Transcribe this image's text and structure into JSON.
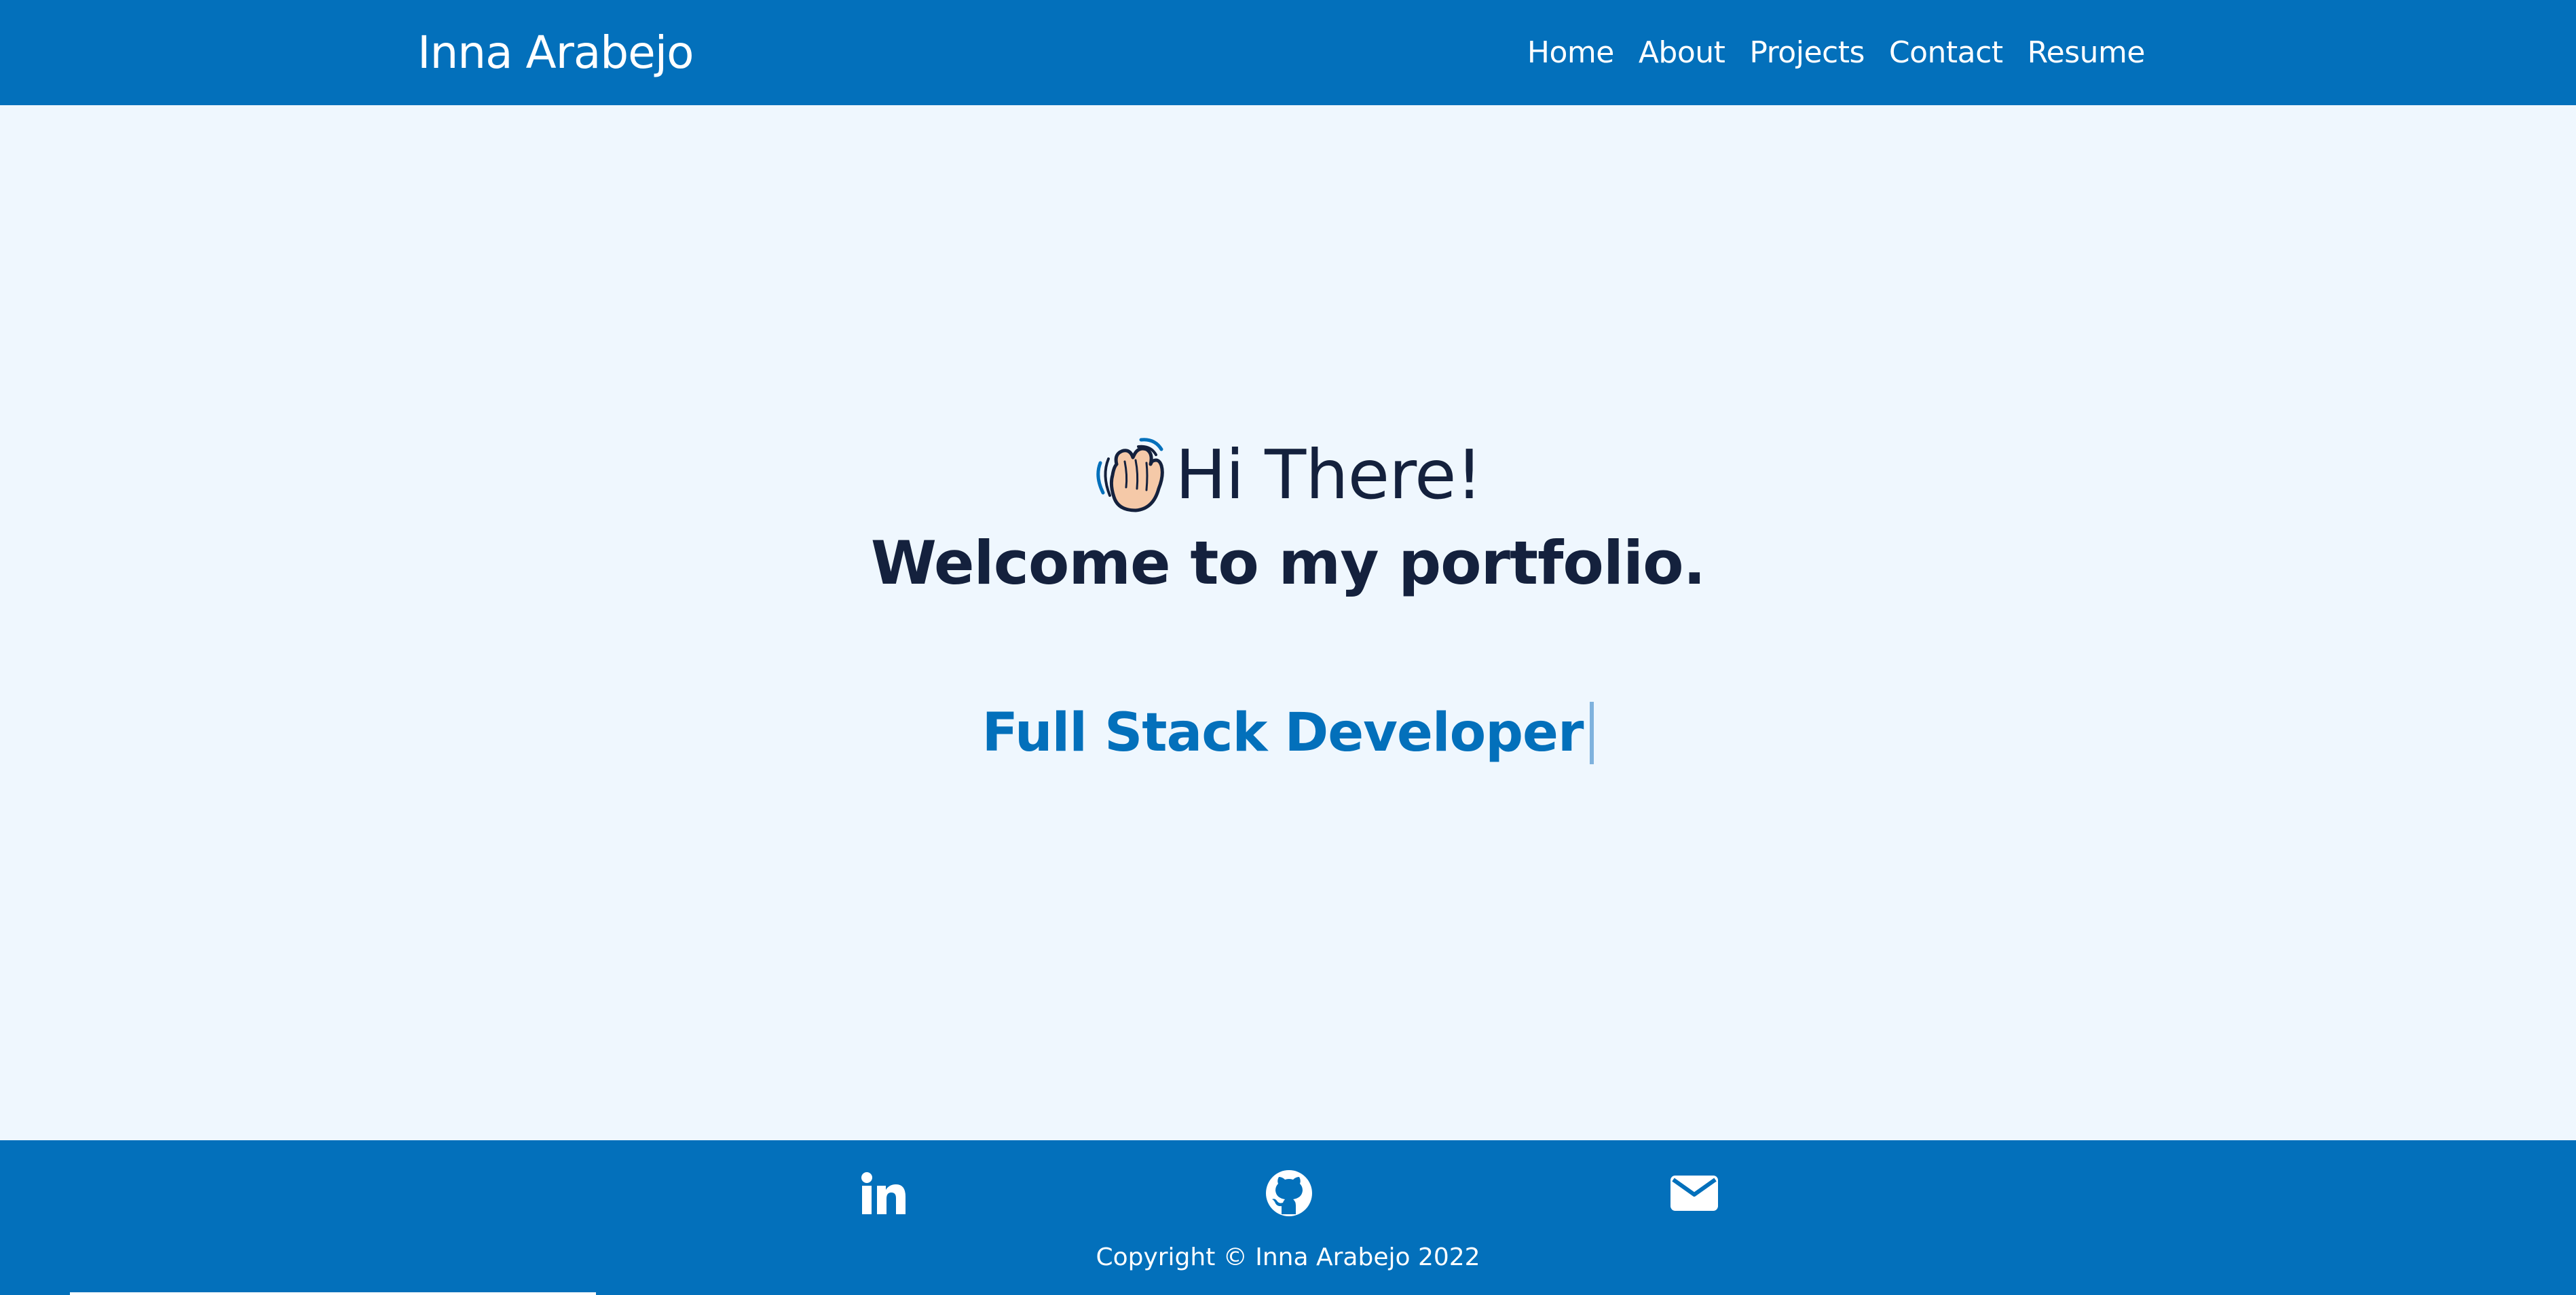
{
  "navbar": {
    "brand": "Inna Arabejo",
    "links": [
      "Home",
      "About",
      "Projects",
      "Contact",
      "Resume"
    ]
  },
  "hero": {
    "wave_icon": "waving-hand-icon",
    "greeting": "Hi There!",
    "welcome": "Welcome to my portfolio.",
    "role": "Full Stack Developer"
  },
  "footer": {
    "social_icons": [
      "linkedin-icon",
      "github-icon",
      "envelope-icon"
    ],
    "copyright": "Copyright © Inna Arabejo 2022"
  },
  "colors": {
    "primary": "#0370bb",
    "background": "#eff7fe",
    "heading": "#14213d",
    "white": "#ffffff"
  }
}
